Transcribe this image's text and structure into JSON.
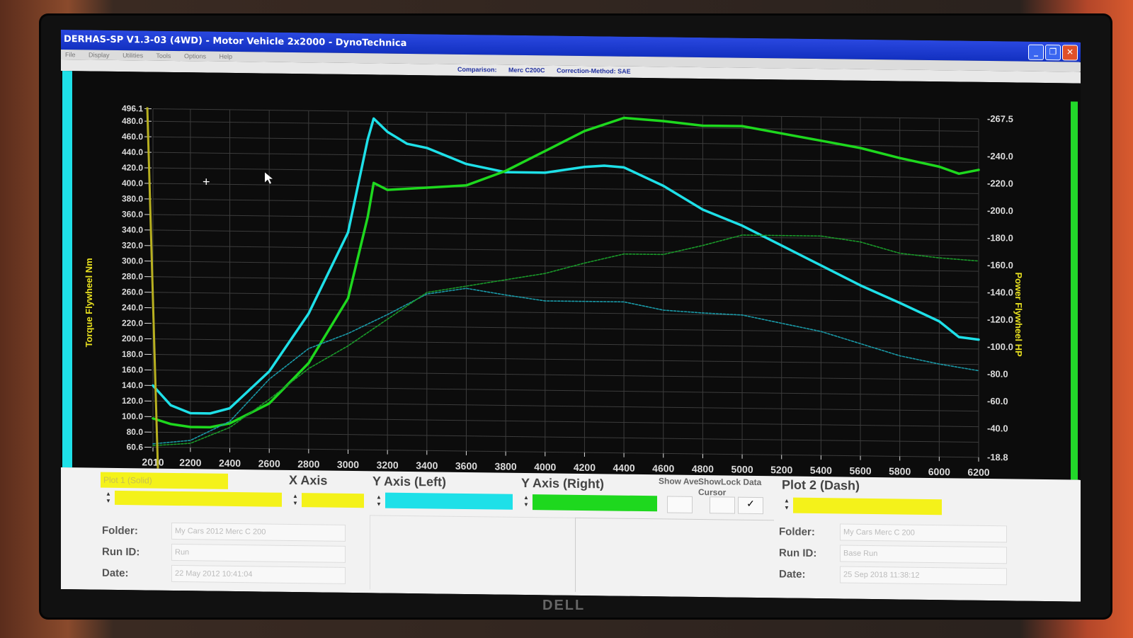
{
  "window": {
    "title": "DERHAS-SP V1.3-03 (4WD) - Motor Vehicle 2x2000 - DynoTechnica",
    "menu": [
      "File",
      "Display",
      "Utilities",
      "Tools",
      "Options",
      "Help"
    ],
    "comparison_label": "Comparison:",
    "comparison_value": "Merc C200C",
    "correction_method": "Correction-Method: SAE"
  },
  "panel": {
    "plot1_label": "Plot 1 (Solid)",
    "x_axis_header": "X Axis",
    "y_left_header": "Y Axis (Left)",
    "y_right_header": "Y Axis (Right)",
    "show_ave": "Show Ave.",
    "show_lock_cursor": "ShowLock Data Cursor",
    "check_mark": "✓",
    "plot2_header": "Plot 2 (Dash)",
    "left_folder_label": "Folder:",
    "left_runid_label": "Run ID:",
    "left_date_label": "Date:",
    "left_folder_value": "My Cars 2012 Merc C 200",
    "left_runid_value": "Run",
    "left_date_value": "22 May 2012 10:41:04",
    "right_folder_label": "Folder:",
    "right_runid_label": "Run ID:",
    "right_date_label": "Date:",
    "right_folder_value": "My Cars Merc C 200",
    "right_runid_value": "Base Run",
    "right_date_value": "25 Sep 2018 11:38:12",
    "colors": {
      "yellow": "#f4f21a",
      "cyan": "#1ee0e8",
      "green": "#1ed81e"
    }
  },
  "monitor_brand": "DELL",
  "chart_data": {
    "type": "line",
    "xlabel": "",
    "ylabel_left": "Torque Flywheel Nm",
    "ylabel_right": "Power Flywheel HP",
    "xlim": [
      2010,
      6200
    ],
    "ylim_left": [
      60.6,
      496.1
    ],
    "ylim_right": [
      18.8,
      267.5
    ],
    "x_ticks": [
      "2010",
      "2200",
      "2400",
      "2600",
      "2800",
      "3000",
      "3200",
      "3400",
      "3600",
      "3800",
      "4000",
      "4200",
      "4400",
      "4600",
      "4800",
      "5000",
      "5200",
      "5400",
      "5600",
      "5800",
      "6000",
      "6200"
    ],
    "y_left_ticks": [
      "496.1",
      "480.0",
      "460.0",
      "440.0",
      "420.0",
      "400.0",
      "380.0",
      "360.0",
      "340.0",
      "320.0",
      "300.0",
      "280.0",
      "260.0",
      "240.0",
      "220.0",
      "200.0",
      "180.0",
      "160.0",
      "140.0",
      "120.0",
      "100.0",
      "80.0",
      "60.6"
    ],
    "y_right_ticks": [
      "267.5",
      "240.0",
      "220.0",
      "200.0",
      "180.0",
      "160.0",
      "140.0",
      "120.0",
      "100.0",
      "80.0",
      "60.0",
      "40.0",
      "18.8"
    ],
    "grid": true,
    "series": [
      {
        "color": "#1ee0e8",
        "axis": "left",
        "style": "solid",
        "x": [
          2010,
          2100,
          2200,
          2300,
          2400,
          2600,
          2800,
          3000,
          3100,
          3130,
          3200,
          3300,
          3400,
          3600,
          3800,
          4000,
          4200,
          4300,
          4400,
          4600,
          4800,
          5000,
          5200,
          5400,
          5600,
          5800,
          6000,
          6100,
          6200
        ],
        "y": [
          140,
          115,
          105,
          105,
          112,
          160,
          235,
          340,
          460,
          487,
          470,
          455,
          450,
          430,
          420,
          420,
          428,
          430,
          428,
          405,
          375,
          355,
          330,
          305,
          280,
          258,
          235,
          215,
          212
        ]
      },
      {
        "color": "#1ed81e",
        "axis": "right",
        "style": "solid",
        "x": [
          2010,
          2100,
          2200,
          2300,
          2400,
          2600,
          2800,
          3000,
          3100,
          3130,
          3200,
          3400,
          3600,
          3800,
          4000,
          4200,
          4400,
          4600,
          4800,
          5000,
          5200,
          5400,
          5600,
          5800,
          6000,
          6100,
          6200
        ],
        "y": [
          40,
          36,
          34,
          34,
          37,
          52,
          82,
          130,
          190,
          215,
          210,
          212,
          214,
          225,
          240,
          255,
          265,
          263,
          260,
          260,
          255,
          250,
          245,
          238,
          232,
          227,
          230
        ]
      },
      {
        "color": "#1a9aa8",
        "axis": "left",
        "style": "dash",
        "x": [
          2010,
          2200,
          2400,
          2600,
          2800,
          3000,
          3200,
          3400,
          3600,
          3800,
          4000,
          4200,
          4400,
          4600,
          4800,
          5000,
          5200,
          5400,
          5600,
          5800,
          6000,
          6200
        ],
        "y": [
          65,
          70,
          95,
          150,
          190,
          210,
          235,
          262,
          270,
          262,
          255,
          255,
          255,
          245,
          242,
          240,
          230,
          220,
          205,
          190,
          180,
          172
        ]
      },
      {
        "color": "#1a9a2a",
        "axis": "right",
        "style": "dash",
        "x": [
          2010,
          2200,
          2400,
          2600,
          2800,
          3000,
          3200,
          3400,
          3600,
          3800,
          4000,
          4200,
          4400,
          4600,
          4800,
          5000,
          5200,
          5400,
          5600,
          5800,
          6000,
          6200
        ],
        "y": [
          20,
          22,
          34,
          55,
          78,
          95,
          115,
          135,
          140,
          145,
          150,
          158,
          165,
          165,
          172,
          180,
          180,
          180,
          176,
          168,
          165,
          163
        ]
      }
    ]
  }
}
